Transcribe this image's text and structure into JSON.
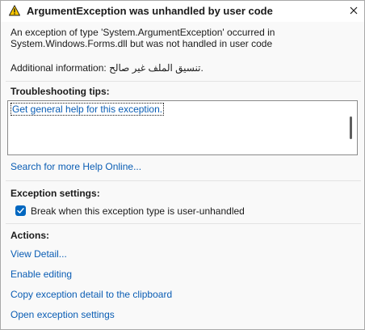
{
  "dialog": {
    "title": "ArgumentException was unhandled by user code",
    "message": "An exception of type 'System.ArgumentException' occurred in System.Windows.Forms.dll but was not handled in user code",
    "additional_info": "Additional information: تنسيق الملف غير صالح."
  },
  "troubleshooting": {
    "heading": "Troubleshooting tips:",
    "tip_link": "Get general help for this exception.",
    "search_link": "Search for more Help Online..."
  },
  "exception_settings": {
    "heading": "Exception settings:",
    "checkbox_label": "Break when this exception type is user-unhandled",
    "checkbox_checked": true
  },
  "actions": {
    "heading": "Actions:",
    "items": [
      "View Detail...",
      "Enable editing",
      "Copy exception detail to the clipboard",
      "Open exception settings"
    ]
  },
  "icons": {
    "title_icon": "warning-icon",
    "close_icon": "close-icon",
    "check_icon": "checkmark-icon"
  },
  "colors": {
    "link": "#0a5db4",
    "checkbox_accent": "#0067c0",
    "warning_fill": "#f7c600"
  }
}
